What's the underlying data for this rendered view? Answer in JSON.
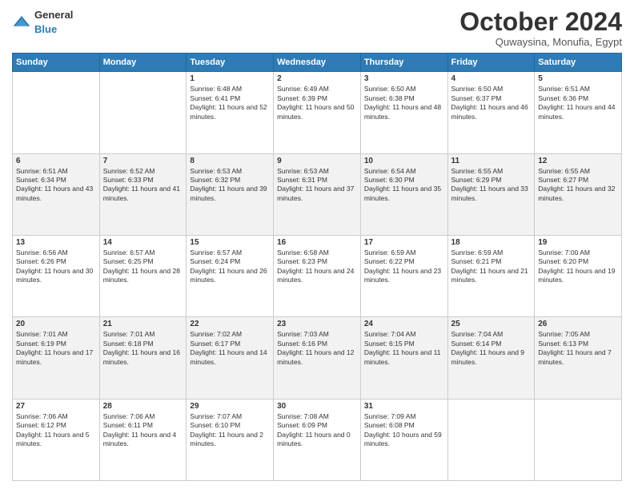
{
  "header": {
    "logo_general": "General",
    "logo_blue": "Blue",
    "month_title": "October 2024",
    "subtitle": "Quwaysina, Monufia, Egypt"
  },
  "days_of_week": [
    "Sunday",
    "Monday",
    "Tuesday",
    "Wednesday",
    "Thursday",
    "Friday",
    "Saturday"
  ],
  "weeks": [
    [
      {
        "day": "",
        "sunrise": "",
        "sunset": "",
        "daylight": ""
      },
      {
        "day": "",
        "sunrise": "",
        "sunset": "",
        "daylight": ""
      },
      {
        "day": "1",
        "sunrise": "Sunrise: 6:48 AM",
        "sunset": "Sunset: 6:41 PM",
        "daylight": "Daylight: 11 hours and 52 minutes."
      },
      {
        "day": "2",
        "sunrise": "Sunrise: 6:49 AM",
        "sunset": "Sunset: 6:39 PM",
        "daylight": "Daylight: 11 hours and 50 minutes."
      },
      {
        "day": "3",
        "sunrise": "Sunrise: 6:50 AM",
        "sunset": "Sunset: 6:38 PM",
        "daylight": "Daylight: 11 hours and 48 minutes."
      },
      {
        "day": "4",
        "sunrise": "Sunrise: 6:50 AM",
        "sunset": "Sunset: 6:37 PM",
        "daylight": "Daylight: 11 hours and 46 minutes."
      },
      {
        "day": "5",
        "sunrise": "Sunrise: 6:51 AM",
        "sunset": "Sunset: 6:36 PM",
        "daylight": "Daylight: 11 hours and 44 minutes."
      }
    ],
    [
      {
        "day": "6",
        "sunrise": "Sunrise: 6:51 AM",
        "sunset": "Sunset: 6:34 PM",
        "daylight": "Daylight: 11 hours and 43 minutes."
      },
      {
        "day": "7",
        "sunrise": "Sunrise: 6:52 AM",
        "sunset": "Sunset: 6:33 PM",
        "daylight": "Daylight: 11 hours and 41 minutes."
      },
      {
        "day": "8",
        "sunrise": "Sunrise: 6:53 AM",
        "sunset": "Sunset: 6:32 PM",
        "daylight": "Daylight: 11 hours and 39 minutes."
      },
      {
        "day": "9",
        "sunrise": "Sunrise: 6:53 AM",
        "sunset": "Sunset: 6:31 PM",
        "daylight": "Daylight: 11 hours and 37 minutes."
      },
      {
        "day": "10",
        "sunrise": "Sunrise: 6:54 AM",
        "sunset": "Sunset: 6:30 PM",
        "daylight": "Daylight: 11 hours and 35 minutes."
      },
      {
        "day": "11",
        "sunrise": "Sunrise: 6:55 AM",
        "sunset": "Sunset: 6:29 PM",
        "daylight": "Daylight: 11 hours and 33 minutes."
      },
      {
        "day": "12",
        "sunrise": "Sunrise: 6:55 AM",
        "sunset": "Sunset: 6:27 PM",
        "daylight": "Daylight: 11 hours and 32 minutes."
      }
    ],
    [
      {
        "day": "13",
        "sunrise": "Sunrise: 6:56 AM",
        "sunset": "Sunset: 6:26 PM",
        "daylight": "Daylight: 11 hours and 30 minutes."
      },
      {
        "day": "14",
        "sunrise": "Sunrise: 6:57 AM",
        "sunset": "Sunset: 6:25 PM",
        "daylight": "Daylight: 11 hours and 28 minutes."
      },
      {
        "day": "15",
        "sunrise": "Sunrise: 6:57 AM",
        "sunset": "Sunset: 6:24 PM",
        "daylight": "Daylight: 11 hours and 26 minutes."
      },
      {
        "day": "16",
        "sunrise": "Sunrise: 6:58 AM",
        "sunset": "Sunset: 6:23 PM",
        "daylight": "Daylight: 11 hours and 24 minutes."
      },
      {
        "day": "17",
        "sunrise": "Sunrise: 6:59 AM",
        "sunset": "Sunset: 6:22 PM",
        "daylight": "Daylight: 11 hours and 23 minutes."
      },
      {
        "day": "18",
        "sunrise": "Sunrise: 6:59 AM",
        "sunset": "Sunset: 6:21 PM",
        "daylight": "Daylight: 11 hours and 21 minutes."
      },
      {
        "day": "19",
        "sunrise": "Sunrise: 7:00 AM",
        "sunset": "Sunset: 6:20 PM",
        "daylight": "Daylight: 11 hours and 19 minutes."
      }
    ],
    [
      {
        "day": "20",
        "sunrise": "Sunrise: 7:01 AM",
        "sunset": "Sunset: 6:19 PM",
        "daylight": "Daylight: 11 hours and 17 minutes."
      },
      {
        "day": "21",
        "sunrise": "Sunrise: 7:01 AM",
        "sunset": "Sunset: 6:18 PM",
        "daylight": "Daylight: 11 hours and 16 minutes."
      },
      {
        "day": "22",
        "sunrise": "Sunrise: 7:02 AM",
        "sunset": "Sunset: 6:17 PM",
        "daylight": "Daylight: 11 hours and 14 minutes."
      },
      {
        "day": "23",
        "sunrise": "Sunrise: 7:03 AM",
        "sunset": "Sunset: 6:16 PM",
        "daylight": "Daylight: 11 hours and 12 minutes."
      },
      {
        "day": "24",
        "sunrise": "Sunrise: 7:04 AM",
        "sunset": "Sunset: 6:15 PM",
        "daylight": "Daylight: 11 hours and 11 minutes."
      },
      {
        "day": "25",
        "sunrise": "Sunrise: 7:04 AM",
        "sunset": "Sunset: 6:14 PM",
        "daylight": "Daylight: 11 hours and 9 minutes."
      },
      {
        "day": "26",
        "sunrise": "Sunrise: 7:05 AM",
        "sunset": "Sunset: 6:13 PM",
        "daylight": "Daylight: 11 hours and 7 minutes."
      }
    ],
    [
      {
        "day": "27",
        "sunrise": "Sunrise: 7:06 AM",
        "sunset": "Sunset: 6:12 PM",
        "daylight": "Daylight: 11 hours and 5 minutes."
      },
      {
        "day": "28",
        "sunrise": "Sunrise: 7:06 AM",
        "sunset": "Sunset: 6:11 PM",
        "daylight": "Daylight: 11 hours and 4 minutes."
      },
      {
        "day": "29",
        "sunrise": "Sunrise: 7:07 AM",
        "sunset": "Sunset: 6:10 PM",
        "daylight": "Daylight: 11 hours and 2 minutes."
      },
      {
        "day": "30",
        "sunrise": "Sunrise: 7:08 AM",
        "sunset": "Sunset: 6:09 PM",
        "daylight": "Daylight: 11 hours and 0 minutes."
      },
      {
        "day": "31",
        "sunrise": "Sunrise: 7:09 AM",
        "sunset": "Sunset: 6:08 PM",
        "daylight": "Daylight: 10 hours and 59 minutes."
      },
      {
        "day": "",
        "sunrise": "",
        "sunset": "",
        "daylight": ""
      },
      {
        "day": "",
        "sunrise": "",
        "sunset": "",
        "daylight": ""
      }
    ]
  ]
}
